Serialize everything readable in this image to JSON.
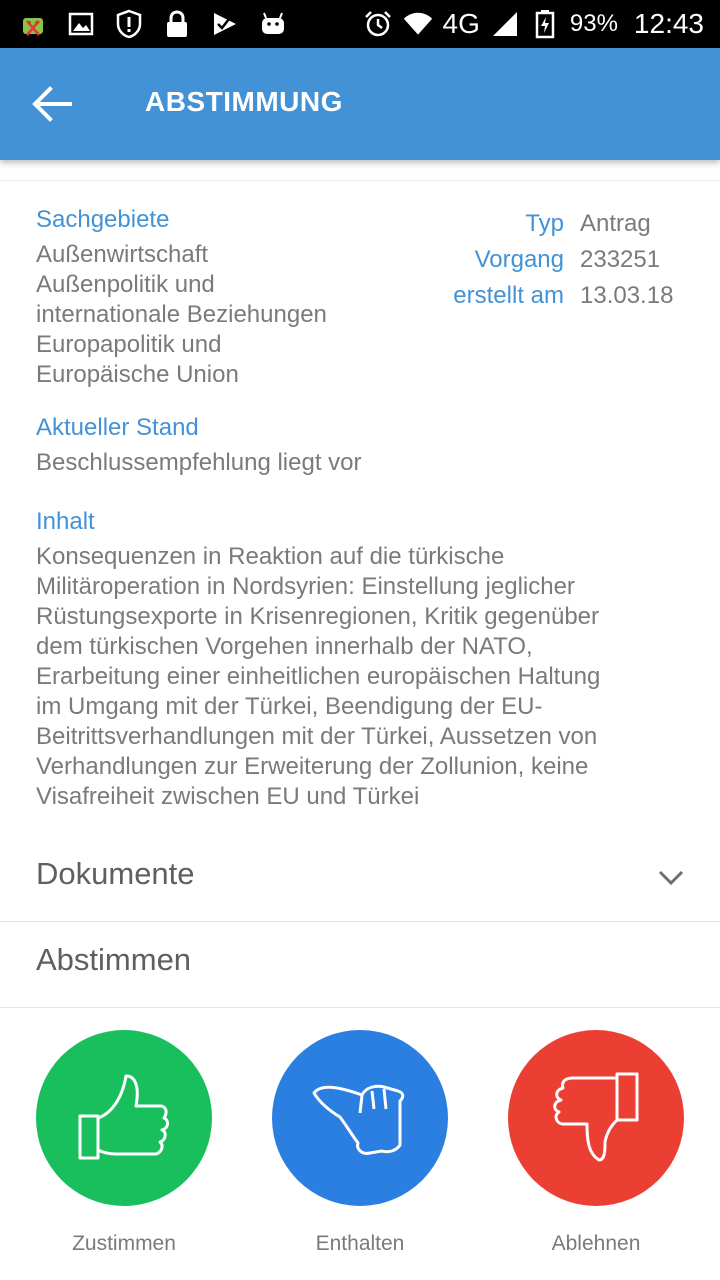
{
  "status_bar": {
    "icons_left": [
      "android-debug-icon",
      "image-icon",
      "shield-alert-icon",
      "lock-icon",
      "check-flag-icon",
      "android-icon"
    ],
    "network": "4G",
    "battery": "93%",
    "time": "12:43"
  },
  "app_bar": {
    "title": "ABSTIMMUNG",
    "accent": "#4392d6"
  },
  "details": {
    "sachgebiete_label": "Sachgebiete",
    "sachgebiete_lines": [
      "Außenwirtschaft",
      "Außenpolitik und",
      "internationale Beziehungen",
      "Europapolitik und",
      "Europäische Union"
    ],
    "meta": [
      {
        "key": "Typ",
        "value": "Antrag"
      },
      {
        "key": "Vorgang",
        "value": "233251"
      },
      {
        "key": "erstellt am",
        "value": "13.03.18"
      }
    ],
    "stand_label": "Aktueller Stand",
    "stand_value": "Beschlussempfehlung liegt vor",
    "inhalt_label": "Inhalt",
    "inhalt_lines": [
      "Konsequenzen in Reaktion auf die türkische",
      "Militäroperation in Nordsyrien: Einstellung jeglicher",
      "Rüstungsexporte in Krisenregionen, Kritik gegenüber",
      "dem türkischen Vorgehen innerhalb der NATO,",
      "Erarbeitung einer einheitlichen europäischen Haltung",
      "im Umgang mit der Türkei, Beendigung der EU-",
      "Beitrittsverhandlungen mit der Türkei, Aussetzen von",
      "Verhandlungen zur Erweiterung der Zollunion, keine",
      "Visafreiheit zwischen EU und Türkei"
    ]
  },
  "sections": {
    "dokumente": "Dokumente",
    "abstimmen": "Abstimmen"
  },
  "votes": [
    {
      "label": "Zustimmen",
      "color": "#19bf5c",
      "icon": "thumbs-up-icon"
    },
    {
      "label": "Enthalten",
      "color": "#2a7fe0",
      "icon": "thumb-sideways-icon"
    },
    {
      "label": "Ablehnen",
      "color": "#ec3f33",
      "icon": "thumbs-down-icon"
    }
  ]
}
